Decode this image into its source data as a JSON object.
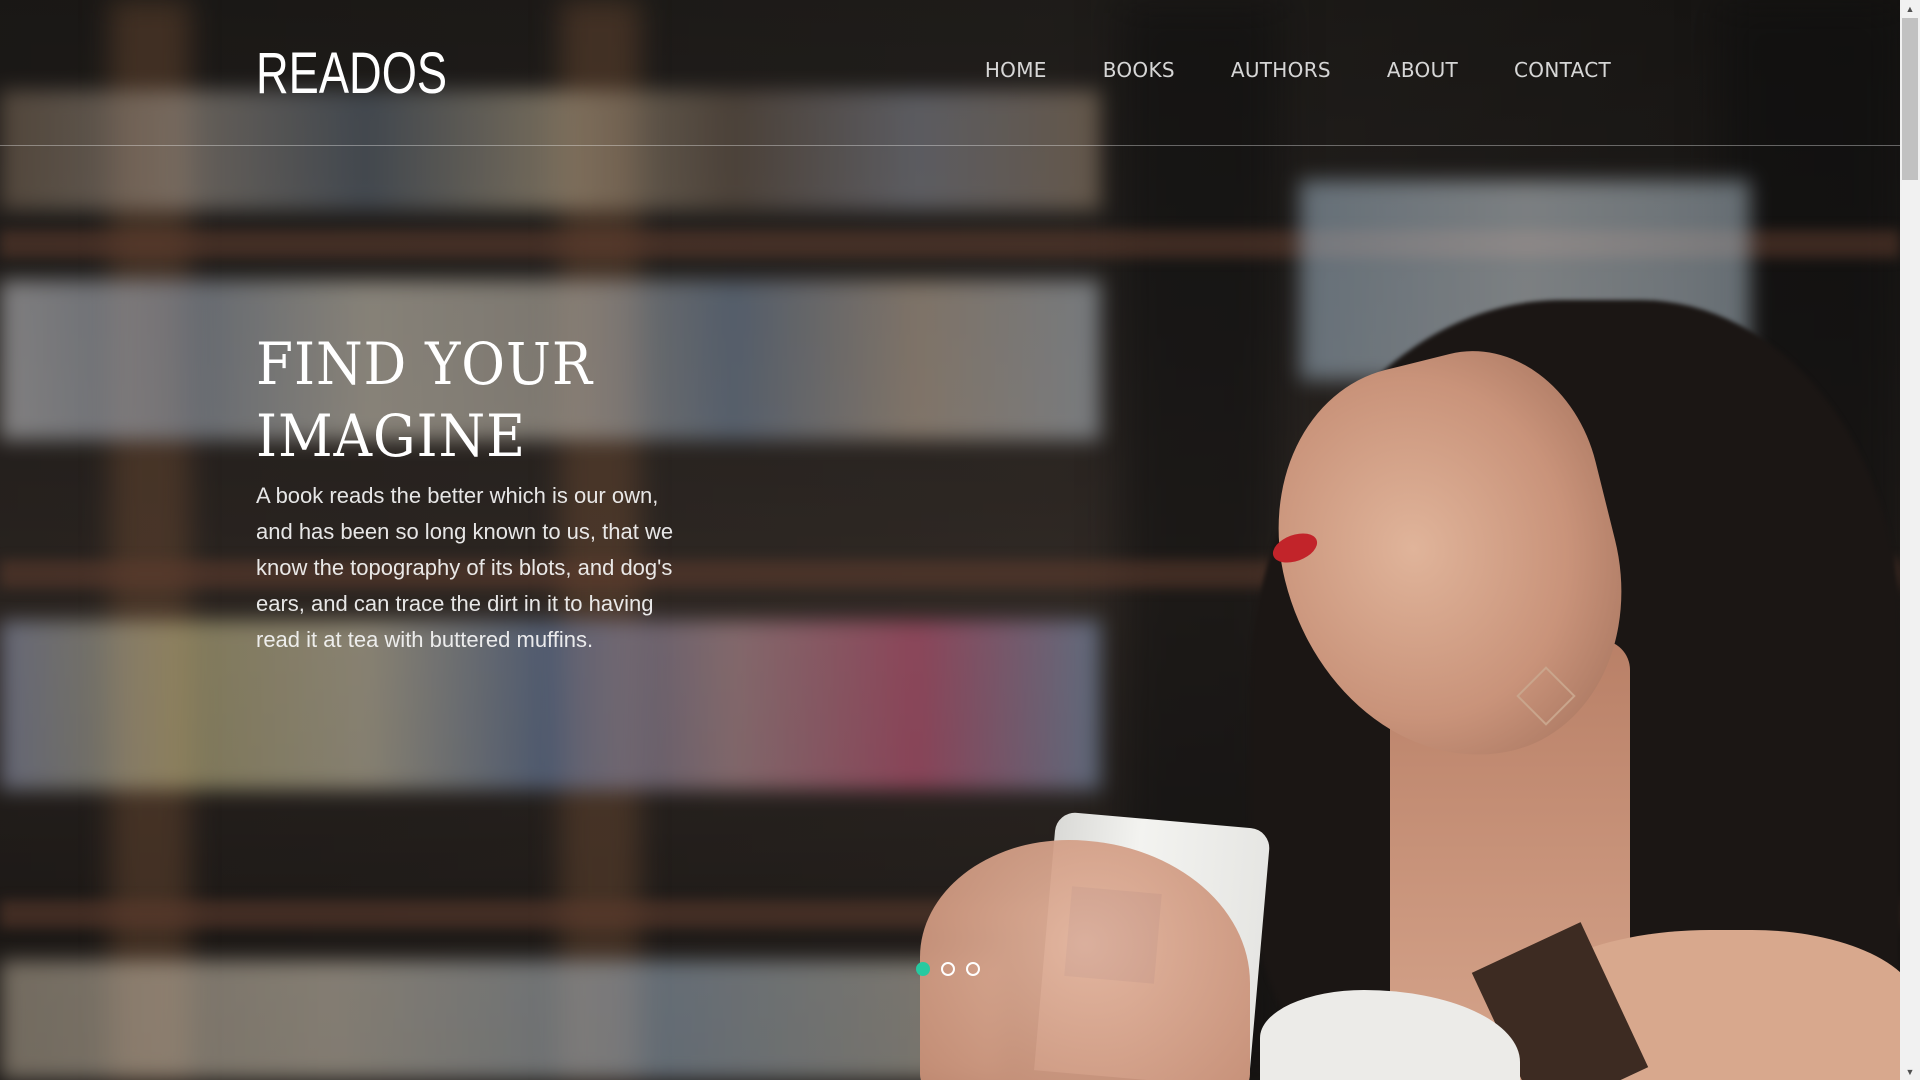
{
  "header": {
    "logo": "READOS",
    "nav": [
      "HOME",
      "BOOKS",
      "AUTHORS",
      "ABOUT",
      "CONTACT"
    ]
  },
  "hero": {
    "headline_line1": "FIND YOUR",
    "headline_line2": "IMAGINE",
    "quote": "A book reads the better which is our own, and has been so long known to us, that we know the topography of its blots, and dog's ears, and can trace the dirt in it to having read it at tea with buttered muffins.",
    "slider": {
      "count": 3,
      "active_index": 0
    }
  },
  "colors": {
    "accent": "#27c9a0",
    "text": "#ffffff"
  },
  "icons": {
    "scroll_up": "triangle-up-icon",
    "scroll_down": "triangle-down-icon"
  }
}
